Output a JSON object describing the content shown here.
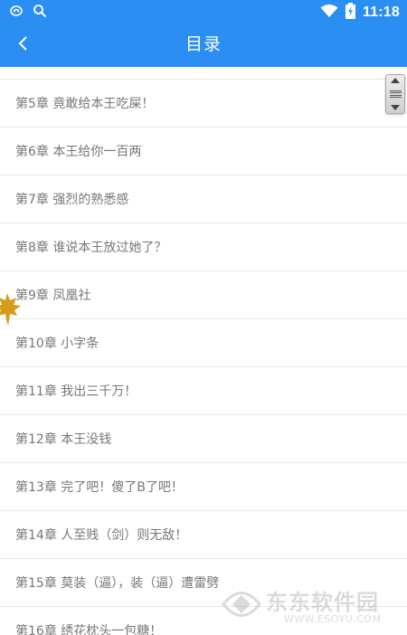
{
  "status_bar": {
    "time": "11:18",
    "icons": {
      "left": [
        "notification-icon",
        "search-icon"
      ],
      "right": [
        "wifi-icon",
        "battery-charging-icon"
      ]
    }
  },
  "header": {
    "title": "目录",
    "back_icon": "chevron-left-icon",
    "background_color": "#2b8ef3"
  },
  "chapters": [
    "第5章 竟敢给本王吃屎！",
    "第6章 本王给你一百两",
    "第7章 强烈的熟悉感",
    "第8章 谁说本王放过她了？",
    "第9章 凤凰社",
    "第10章 小字条",
    "第11章 我出三千万！",
    "第12章 本王没钱",
    "第13章 完了吧！傻了B了吧！",
    "第14章 人至贱（剑）则无敌！",
    "第15章 莫装（逼），装（逼）遭雷劈",
    "第16章 绣花枕头一包糖！"
  ],
  "scroll_control": {
    "icons": [
      "arrow-up-icon",
      "grip-icon",
      "arrow-down-icon"
    ]
  },
  "watermark": {
    "text": "东东软件园",
    "url": "WWW.ESOYU.COM"
  }
}
